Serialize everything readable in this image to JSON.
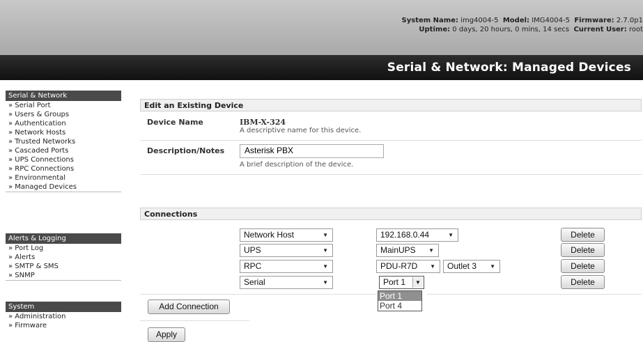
{
  "header": {
    "system_name_label": "System Name:",
    "system_name": "img4004-5",
    "model_label": "Model:",
    "model": "IMG4004-5",
    "firmware_label": "Firmware:",
    "firmware": "2.7.0p1",
    "uptime_label": "Uptime:",
    "uptime": "0 days, 20 hours, 0 mins, 14 secs",
    "current_user_label": "Current User:",
    "current_user": "root",
    "page_title": "Serial & Network: Managed Devices"
  },
  "sidebar": {
    "serial_network": {
      "title": "Serial & Network",
      "items": [
        "» Serial Port",
        "» Users & Groups",
        "» Authentication",
        "» Network Hosts",
        "» Trusted Networks",
        "» Cascaded Ports",
        "» UPS Connections",
        "» RPC Connections",
        "» Environmental",
        "» Managed Devices"
      ]
    },
    "alerts_logging": {
      "title": "Alerts & Logging",
      "items": [
        "» Port Log",
        "» Alerts",
        "» SMTP & SMS",
        "» SNMP"
      ]
    },
    "system": {
      "title": "System",
      "items": [
        "» Administration",
        "» Firmware"
      ]
    }
  },
  "edit_section": {
    "title": "Edit an Existing Device",
    "device_name_label": "Device Name",
    "device_name_value": "IBM-X-324",
    "device_name_desc": "A descriptive name for this device.",
    "description_label": "Description/Notes",
    "description_value": "Asterisk PBX",
    "description_desc": "A brief description of the device."
  },
  "connections": {
    "title": "Connections",
    "rows": [
      {
        "type": "Network Host",
        "target": "192.168.0.44",
        "delete_label": "Delete"
      },
      {
        "type": "UPS",
        "target": "MainUPS",
        "delete_label": "Delete"
      },
      {
        "type": "RPC",
        "target": "PDU-R7D",
        "outlet": "Outlet 3",
        "delete_label": "Delete"
      },
      {
        "type": "Serial",
        "target": "Port 1",
        "delete_label": "Delete"
      }
    ],
    "open_dropdown_options": [
      "Port 1",
      "Port 4"
    ],
    "add_button": "Add Connection",
    "apply_button": "Apply"
  }
}
